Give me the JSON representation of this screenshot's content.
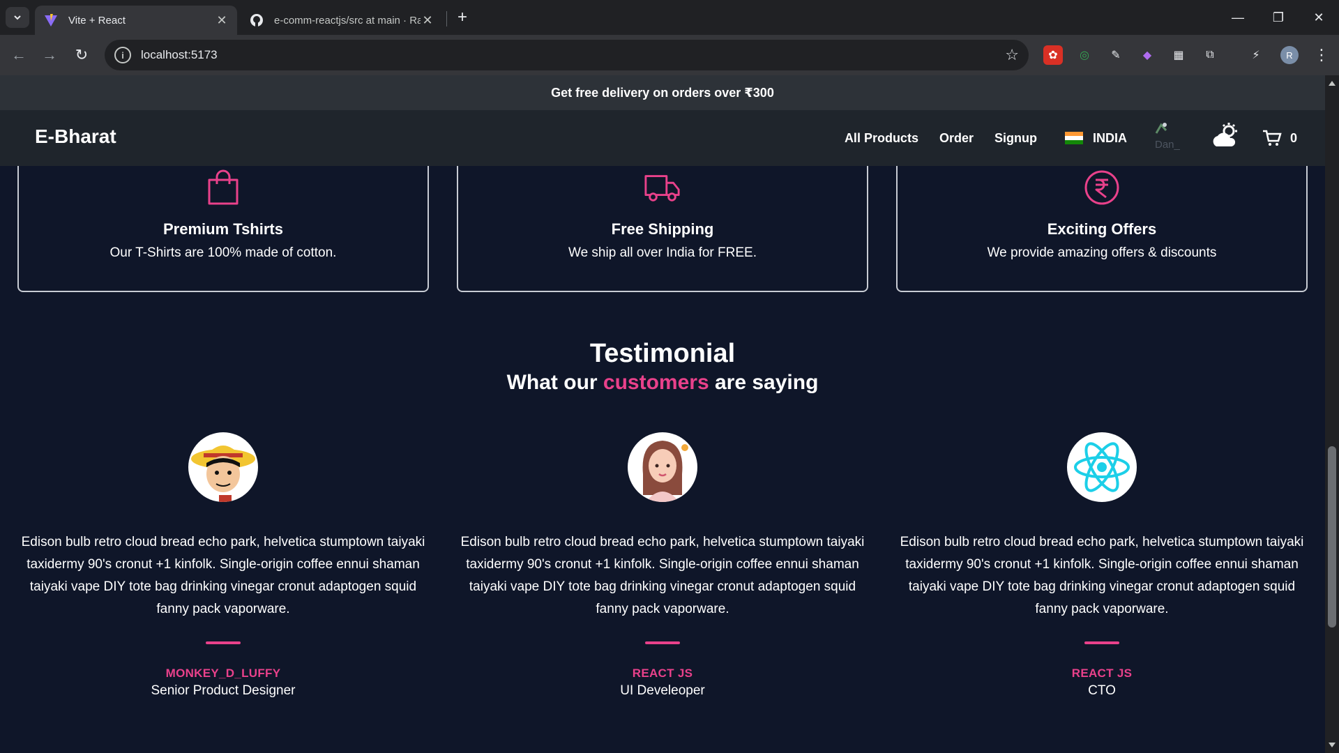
{
  "browser": {
    "tabs": [
      {
        "title": "Vite + React",
        "active": true
      },
      {
        "title": "e-comm-reactjs/src at main · Ra",
        "active": false
      }
    ],
    "url": "localhost:5173",
    "profile_initial": "R"
  },
  "promo": {
    "text": "Get free delivery on orders over ₹300"
  },
  "nav": {
    "brand": "E-Bharat",
    "links": [
      "All Products",
      "Order",
      "Signup"
    ],
    "country": "INDIA",
    "user_alt": "Dan_",
    "cart_count": "0"
  },
  "features": [
    {
      "icon": "shopping-bag-icon",
      "title": "Premium Tshirts",
      "desc": "Our T-Shirts are 100% made of cotton."
    },
    {
      "icon": "truck-icon",
      "title": "Free Shipping",
      "desc": "We ship all over India for FREE."
    },
    {
      "icon": "rupee-icon",
      "title": "Exciting Offers",
      "desc": "We provide amazing offers & discounts"
    }
  ],
  "testimonial_section": {
    "title": "Testimonial",
    "subtitle_prefix": "What our ",
    "subtitle_accent": "customers",
    "subtitle_suffix": " are saying"
  },
  "testimonials": [
    {
      "quote": "Edison bulb retro cloud bread echo park, helvetica stumptown taiyaki taxidermy 90's cronut +1 kinfolk. Single-origin coffee ennui shaman taiyaki vape DIY tote bag drinking vinegar cronut adaptogen squid fanny pack vaporware.",
      "name": "MONKEY_D_LUFFY",
      "role": "Senior Product Designer"
    },
    {
      "quote": "Edison bulb retro cloud bread echo park, helvetica stumptown taiyaki taxidermy 90's cronut +1 kinfolk. Single-origin coffee ennui shaman taiyaki vape DIY tote bag drinking vinegar cronut adaptogen squid fanny pack vaporware.",
      "name": "REACT JS",
      "role": "UI Develeoper"
    },
    {
      "quote": "Edison bulb retro cloud bread echo park, helvetica stumptown taiyaki taxidermy 90's cronut +1 kinfolk. Single-origin coffee ennui shaman taiyaki vape DIY tote bag drinking vinegar cronut adaptogen squid fanny pack vaporware.",
      "name": "REACT JS",
      "role": "CTO"
    }
  ],
  "colors": {
    "accent": "#e9418b",
    "page_bg": "#0f1629",
    "nav_bg": "#1f252c",
    "promo_bg": "#2d3238"
  }
}
